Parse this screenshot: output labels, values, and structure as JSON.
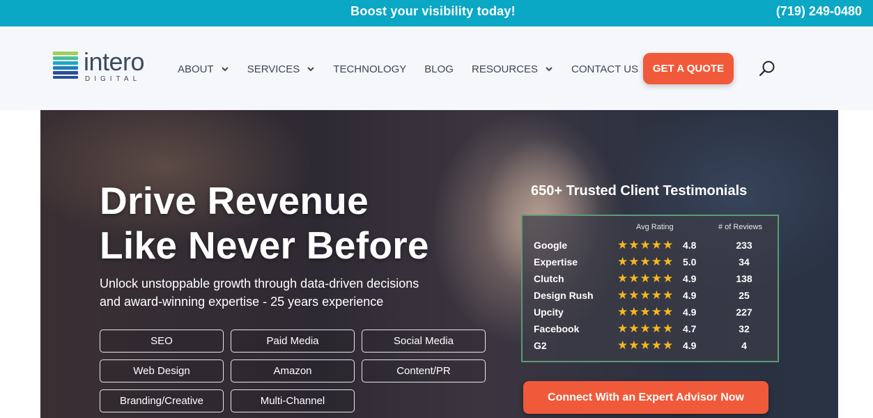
{
  "topbar": {
    "promo": "Boost your visibility today!",
    "phone": "(719) 249-0480",
    "bg_color": "#0aa8c4"
  },
  "logo": {
    "word": "intero",
    "sub": "DIGITAL",
    "stripe_colors": [
      "#9ccf5b",
      "#4cbf9a",
      "#1aa9c3",
      "#1f7fb7",
      "#27509a"
    ]
  },
  "nav": {
    "items": [
      {
        "label": "ABOUT",
        "has_dropdown": true
      },
      {
        "label": "SERVICES",
        "has_dropdown": true
      },
      {
        "label": "TECHNOLOGY",
        "has_dropdown": false
      },
      {
        "label": "BLOG",
        "has_dropdown": false
      },
      {
        "label": "RESOURCES",
        "has_dropdown": true
      },
      {
        "label": "CONTACT US",
        "has_dropdown": false
      }
    ],
    "quote_button": "GET A QUOTE",
    "search_icon": "search-icon",
    "accent_color": "#f05a3a"
  },
  "hero": {
    "title_line1": "Drive Revenue",
    "title_line2": "Like Never Before",
    "subtitle_line1": "Unlock unstoppable growth through data-driven decisions",
    "subtitle_line2": "and award-winning expertise - 25 years experience",
    "services": [
      "SEO",
      "Paid Media",
      "Social Media",
      "Web Design",
      "Amazon",
      "Content/PR",
      "Branding/Creative",
      "Multi-Channel"
    ]
  },
  "testimonials": {
    "title": "650+ Trusted Client Testimonials",
    "col_rating": "Avg Rating",
    "col_reviews": "# of Reviews",
    "stars": "★★★★★",
    "rows": [
      {
        "name": "Google",
        "rating": "4.8",
        "reviews": "233"
      },
      {
        "name": "Expertise",
        "rating": "5.0",
        "reviews": "34"
      },
      {
        "name": "Clutch",
        "rating": "4.9",
        "reviews": "138"
      },
      {
        "name": "Design Rush",
        "rating": "4.9",
        "reviews": "25"
      },
      {
        "name": "Upcity",
        "rating": "4.9",
        "reviews": "227"
      },
      {
        "name": "Facebook",
        "rating": "4.7",
        "reviews": "32"
      },
      {
        "name": "G2",
        "rating": "4.9",
        "reviews": "4"
      }
    ],
    "cta": "Connect With an Expert Advisor Now"
  }
}
